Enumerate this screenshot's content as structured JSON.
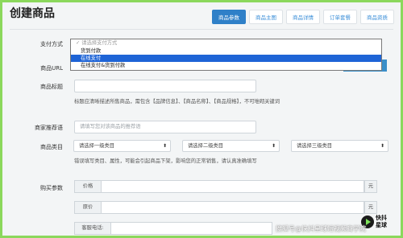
{
  "page": {
    "title": "创建商品"
  },
  "tabs": [
    {
      "label": "商品参数",
      "active": true
    },
    {
      "label": "商品主图",
      "active": false
    },
    {
      "label": "商品详情",
      "active": false
    },
    {
      "label": "订单套餐",
      "active": false
    },
    {
      "label": "商品资质",
      "active": false
    }
  ],
  "form": {
    "payment": {
      "label": "支付方式",
      "placeholder": "✓ 请选择支付方式",
      "options": [
        "货到付款",
        "在线支付",
        "在线支付&货到付款"
      ],
      "selected": "在线支付"
    },
    "url": {
      "label": "商品URL"
    },
    "title": {
      "label": "商品标题",
      "help": "标题应清晰描述所售商品，需包含【品牌信息】、【商品名称】、【商品规格】，不可堆砌关键词"
    },
    "recommend": {
      "label": "商家推荐语",
      "placeholder": "请填写您对该商品的推荐语"
    },
    "category": {
      "label": "商品类目",
      "level1": "请选择一级类目",
      "level2": "请选择二级类目",
      "level3": "请选择三级类目",
      "help": "错误填写类目、属性，可能会引起商品下架，影响您的正常销售，请认真准确填写"
    },
    "purchase": {
      "label": "购买参数",
      "price_label": "价格",
      "original_label": "原价",
      "unit": "元",
      "service_label": "客服电话:"
    }
  },
  "branding": {
    "logo_line1": "快抖",
    "logo_line2": "星球",
    "watermark": "搜狐号@快抖星球短视频商学院"
  },
  "colors": {
    "accent": "#2f80c8",
    "frame": "#8bd85c",
    "selected_option": "#1e64d6"
  }
}
